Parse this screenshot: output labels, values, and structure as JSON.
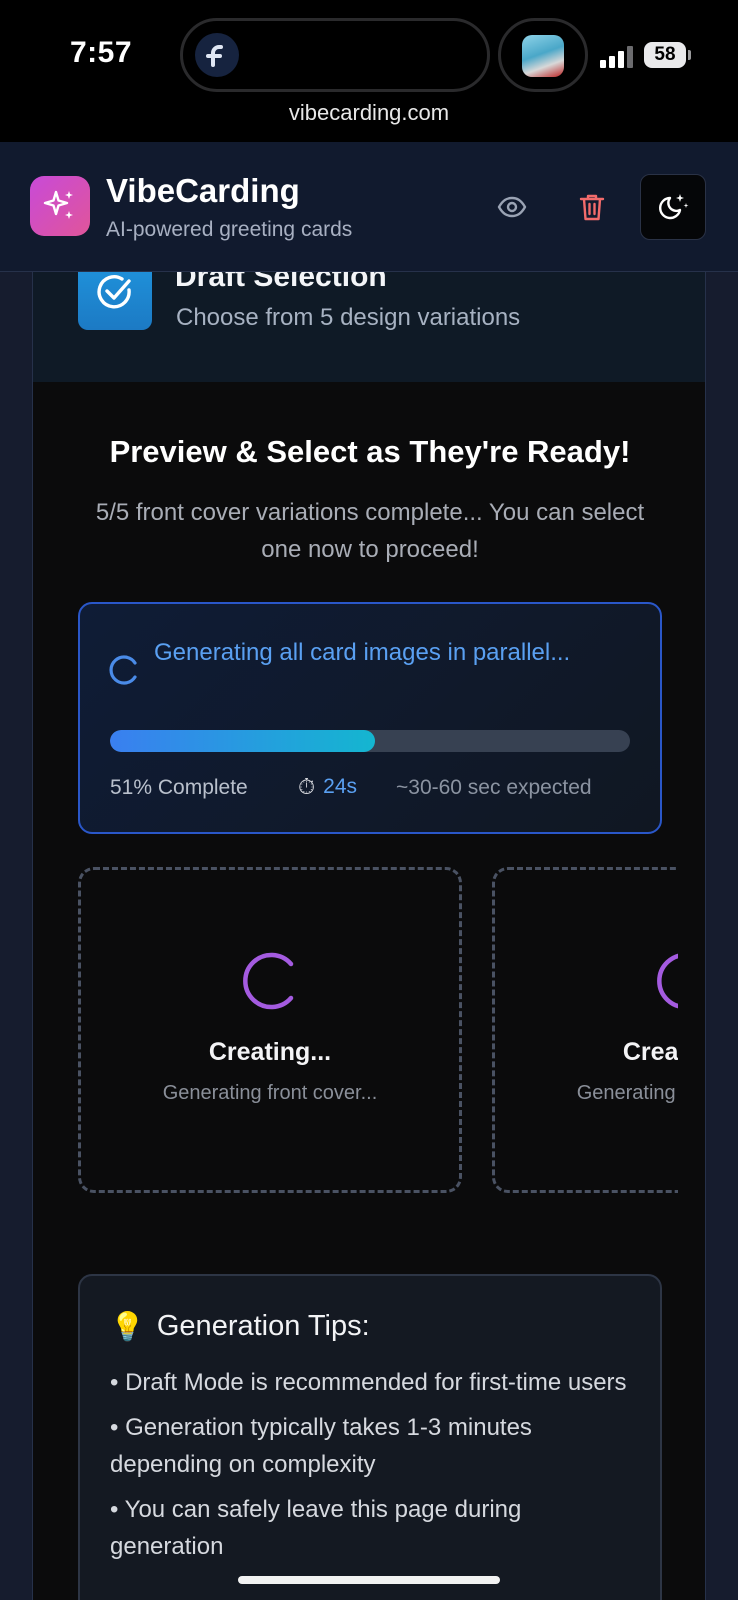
{
  "status_bar": {
    "time": "7:57",
    "battery": "58",
    "url": "vibecarding.com"
  },
  "header": {
    "app_name": "VibeCarding",
    "tagline": "AI-powered greeting cards",
    "logo_icon": "sparkles-icon",
    "actions": [
      "eye-icon",
      "trash-icon",
      "moon-stars-icon"
    ],
    "trash_color": "#f26b6b"
  },
  "step": {
    "title": "Draft Selection",
    "subtitle": "Choose from 5 design variations"
  },
  "main": {
    "title": "Preview & Select as They're Ready!",
    "description": "5/5 front cover variations complete... You can select one now to proceed!"
  },
  "progress": {
    "label": "Generating all card images in parallel...",
    "percent": 51,
    "percent_text": "51% Complete",
    "elapsed": "24s",
    "expected": "~30-60 sec expected",
    "accent": "#5aa0f2"
  },
  "cards": [
    {
      "title": "Creating...",
      "subtitle": "Generating front cover..."
    },
    {
      "title": "Creating...",
      "subtitle": "Generating front cover..."
    }
  ],
  "tips": {
    "title": "Generation Tips:",
    "items": [
      "• Draft Mode is recommended for first-time users",
      "• Generation typically takes 1-3 minutes depending on complexity",
      "• You can safely leave this page during generation"
    ]
  }
}
